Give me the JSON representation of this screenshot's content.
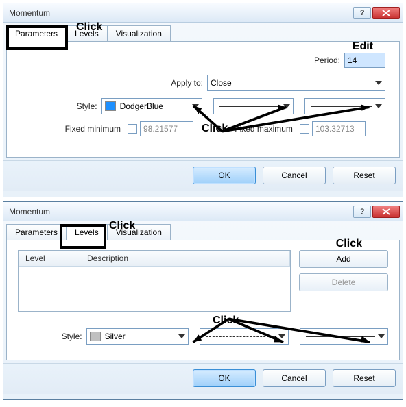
{
  "dialogs": [
    {
      "title": "Momentum",
      "tabs": [
        "Parameters",
        "Levels",
        "Visualization"
      ],
      "active_tab": "Parameters",
      "annotations": {
        "click_tab": "Click",
        "edit": "Edit",
        "click_style": "Click"
      },
      "fields": {
        "period_label": "Period:",
        "period_value": "14",
        "apply_label": "Apply to:",
        "apply_value": "Close",
        "style_label": "Style:",
        "style_color_name": "DodgerBlue",
        "style_color_hex": "#1e90ff",
        "fixed_min_label": "Fixed minimum",
        "fixed_min_value": "98.21577",
        "fixed_max_label": "Fixed maximum",
        "fixed_max_value": "103.32713"
      },
      "buttons": {
        "ok": "OK",
        "cancel": "Cancel",
        "reset": "Reset"
      }
    },
    {
      "title": "Momentum",
      "tabs": [
        "Parameters",
        "Levels",
        "Visualization"
      ],
      "active_tab": "Levels",
      "annotations": {
        "click_tab": "Click",
        "click_add": "Click",
        "click_style": "Click"
      },
      "list": {
        "col_level": "Level",
        "col_desc": "Description"
      },
      "side": {
        "add": "Add",
        "delete": "Delete"
      },
      "style": {
        "label": "Style:",
        "color_name": "Silver",
        "color_hex": "#c0c0c0"
      },
      "buttons": {
        "ok": "OK",
        "cancel": "Cancel",
        "reset": "Reset"
      }
    }
  ]
}
